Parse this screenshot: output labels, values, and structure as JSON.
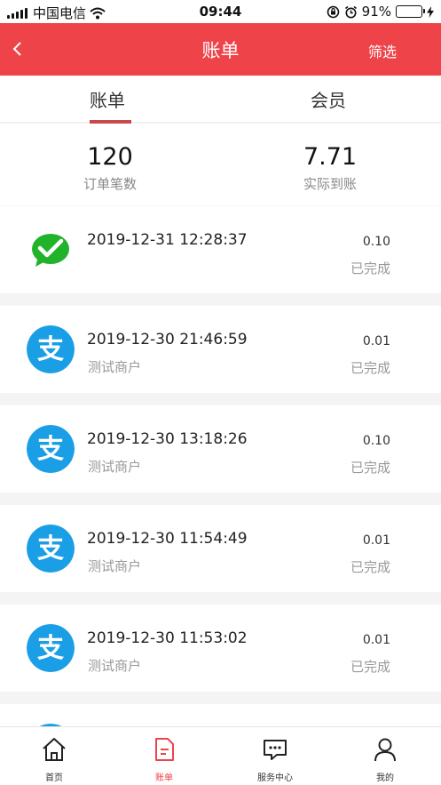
{
  "status_bar": {
    "carrier": "中国电信",
    "time": "09:44",
    "battery": "91%",
    "battery_level": 0.91
  },
  "nav": {
    "title": "账单",
    "filter_label": "筛选"
  },
  "tabs": [
    {
      "label": "账单",
      "active": true
    },
    {
      "label": "会员",
      "active": false
    }
  ],
  "summary": {
    "order_count": "120",
    "order_count_label": "订单笔数",
    "settled_amount": "7.71",
    "settled_amount_label": "实际到账"
  },
  "transactions": [
    {
      "method": "wechat-icon",
      "time": "2019-12-31 12:28:37",
      "merchant": "",
      "amount": "0.10",
      "status": "已完成"
    },
    {
      "method": "alipay-icon",
      "time": "2019-12-30 21:46:59",
      "merchant": "测试商户",
      "amount": "0.01",
      "status": "已完成"
    },
    {
      "method": "alipay-icon",
      "time": "2019-12-30 13:18:26",
      "merchant": "测试商户",
      "amount": "0.10",
      "status": "已完成"
    },
    {
      "method": "alipay-icon",
      "time": "2019-12-30 11:54:49",
      "merchant": "测试商户",
      "amount": "0.01",
      "status": "已完成"
    },
    {
      "method": "alipay-icon",
      "time": "2019-12-30 11:53:02",
      "merchant": "测试商户",
      "amount": "0.01",
      "status": "已完成"
    }
  ],
  "bottom_nav": [
    {
      "label": "首页",
      "icon": "home-icon",
      "active": false
    },
    {
      "label": "账单",
      "icon": "bill-icon",
      "active": true
    },
    {
      "label": "服务中心",
      "icon": "service-chat-icon",
      "active": false
    },
    {
      "label": "我的",
      "icon": "user-icon",
      "active": false
    }
  ],
  "colors": {
    "brand": "#ef434a",
    "wechat": "#21b32a",
    "alipay": "#1a9fe6"
  }
}
